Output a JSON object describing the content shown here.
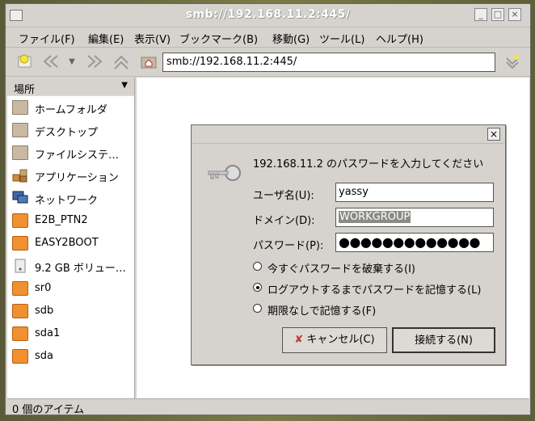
{
  "window": {
    "title": "smb://192.168.11.2:445/"
  },
  "menu": [
    "ファイル(F)",
    "編集(E)",
    "表示(V)",
    "ブックマーク(B)",
    "移動(G)",
    "ツール(L)",
    "ヘルプ(H)"
  ],
  "toolbar": {
    "address": "smb://192.168.11.2:445/"
  },
  "sidebar": {
    "header": "場所",
    "items": [
      {
        "label": "ホームフォルダ",
        "icon": "home-folder-icon"
      },
      {
        "label": "デスクトップ",
        "icon": "desktop-folder-icon"
      },
      {
        "label": "ファイルシステ…",
        "icon": "filesystem-folder-icon"
      },
      {
        "label": "アプリケーション",
        "icon": "applications-icon"
      },
      {
        "label": "ネットワーク",
        "icon": "network-icon"
      },
      {
        "label": "E2B_PTN2",
        "icon": "drive-icon"
      },
      {
        "label": "EASY2BOOT",
        "icon": "drive-icon"
      },
      {
        "label": "9.2 GB ボリュー…",
        "icon": "disk-icon"
      },
      {
        "label": "sr0",
        "icon": "drive-icon"
      },
      {
        "label": "sdb",
        "icon": "drive-icon"
      },
      {
        "label": "sda1",
        "icon": "drive-icon"
      },
      {
        "label": "sda",
        "icon": "drive-icon"
      }
    ]
  },
  "statusbar": {
    "text": "0 個のアイテム"
  },
  "dialog": {
    "prompt": "192.168.11.2 のパスワードを入力してください",
    "username_label": "ユーザ名(U):",
    "username_value": "yassy",
    "domain_label": "ドメイン(D):",
    "domain_value": "WORKGROUP",
    "password_label": "パスワード(P):",
    "password_value": "●●●●●●●●●●●●●",
    "radio": [
      {
        "label": "今すぐパスワードを破棄する(I)",
        "checked": false
      },
      {
        "label": "ログアウトするまでパスワードを記憶する(L)",
        "checked": true
      },
      {
        "label": "期限なしで記憶する(F)",
        "checked": false
      }
    ],
    "cancel_label": "キャンセル(C)",
    "connect_label": "接続する(N)"
  }
}
